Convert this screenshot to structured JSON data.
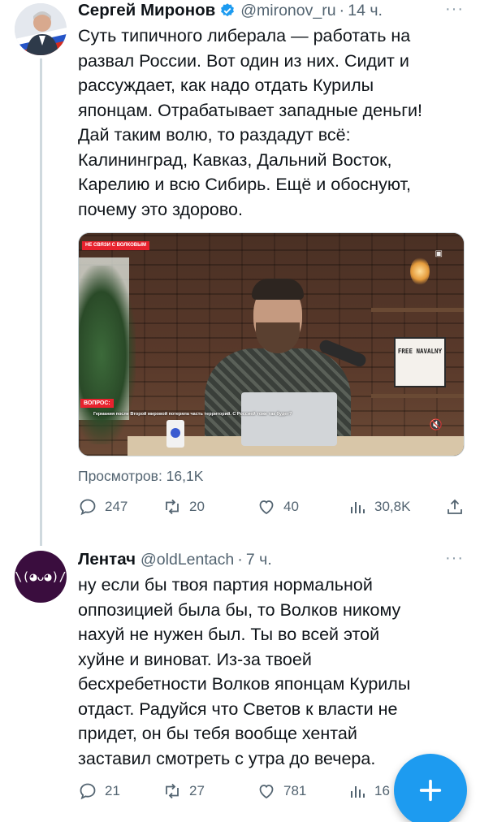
{
  "tweet1": {
    "author_name": "Сергей Миронов",
    "handle": "@mironov_ru",
    "separator": "·",
    "time": "14 ч.",
    "text_lines": [
      "Суть типичного либерала — работать на",
      "развал России. Вот один из них. Сидит и",
      "рассуждает, как надо отдать Курилы",
      "японцам. Отрабатывает западные деньги!",
      "Дай таким волю, то раздадут всё:",
      "Калининград, Кавказ, Дальний Восток,",
      "Карелию и всю Сибирь. Ещё и обоснуют,",
      "почему это здорово."
    ],
    "video": {
      "badge": "НЕ СВЯЗИ С ВОЛКОВЫМ",
      "question_label": "ВОПРОС:",
      "question_text": "Германия после Второй мировой потеряла часть территорий. С Россией тоже так будет?",
      "sign_text": "FREE NAVALNY"
    },
    "views": "Просмотров: 16,1K",
    "stats": {
      "replies": "247",
      "retweets": "20",
      "likes": "40",
      "analytics": "30,8K"
    }
  },
  "tweet2": {
    "author_name": "Лентач",
    "handle": "@oldLentach",
    "separator": "·",
    "time": "7 ч.",
    "avatar_text": "\\(◕ᴗ◕)/",
    "text_lines": [
      "ну если бы твоя партия нормальной",
      "оппозицией была бы, то Волков никому",
      "нахуй не нужен был. Ты во всей этой",
      "хуйне и виноват. Из-за твоей",
      "бесхребетности Волков японцам Курилы",
      "отдаст. Радуйся что Светов к власти не",
      "придет, он бы тебя вообще хентай",
      "заставил смотреть с утра до вечера."
    ],
    "stats": {
      "replies": "21",
      "retweets": "27",
      "likes": "781",
      "analytics": "16"
    }
  },
  "more_label": "···",
  "colors": {
    "accent": "#1d9bf0",
    "secondary_text": "#536471",
    "primary_text": "#0f1419"
  }
}
